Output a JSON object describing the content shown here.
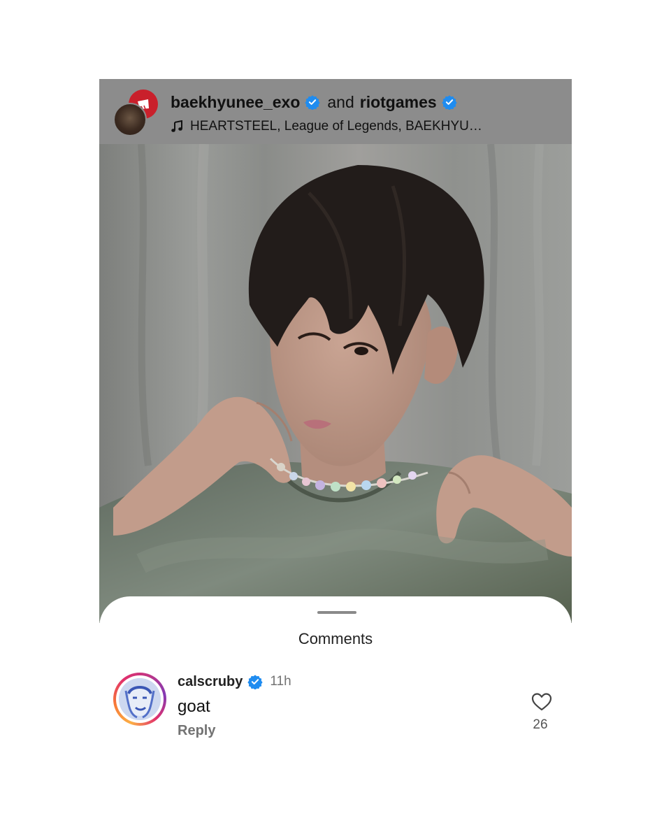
{
  "post": {
    "author": "baekhyunee_exo",
    "connector": "and",
    "collaborator": "riotgames",
    "audio": "HEARTSTEEL, League of Legends, BAEKHYU…"
  },
  "sheet": {
    "title": "Comments"
  },
  "comment": {
    "username": "calscruby",
    "time": "11h",
    "text": "goat",
    "reply_label": "Reply",
    "likes": "26"
  },
  "colors": {
    "verified_blue": "#1f8cf0",
    "riot_red": "#c9202b",
    "header_overlay": "#8c8c8c"
  },
  "icons": [
    "verified-badge-icon",
    "music-note-icon",
    "riot-fist-icon",
    "heart-icon"
  ]
}
